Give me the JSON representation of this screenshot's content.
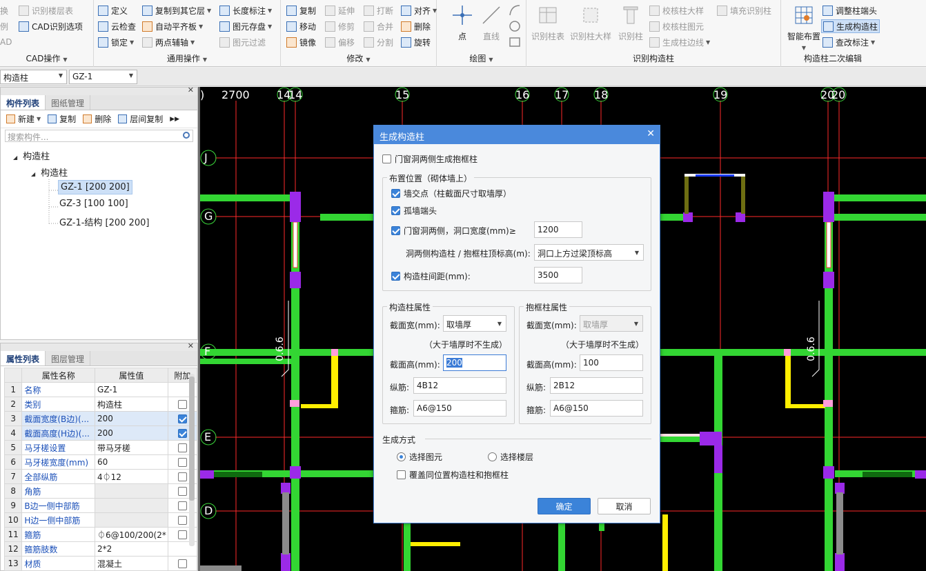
{
  "ribbon": {
    "cad_group": {
      "label": "CAD操作",
      "items": [
        "识别楼层表",
        "CAD识别选项"
      ],
      "partial_items": [
        "换",
        "例",
        "AD"
      ]
    },
    "general_group": {
      "label": "通用操作",
      "items": [
        "定义",
        "复制到其它层",
        "长度标注",
        "云检查",
        "自动平齐板",
        "图元存盘",
        "锁定",
        "两点辅轴",
        "图元过滤"
      ]
    },
    "modify_group": {
      "label": "修改",
      "items": [
        "复制",
        "延伸",
        "打断",
        "对齐",
        "移动",
        "修剪",
        "合并",
        "删除",
        "镜像",
        "偏移",
        "分割",
        "旋转"
      ]
    },
    "draw_group": {
      "label": "绘图",
      "items": [
        "点",
        "直线"
      ]
    },
    "identify_group": {
      "label": "识别构造柱",
      "items": [
        "识别柱表",
        "识别柱大样",
        "识别柱",
        "校核柱大样",
        "填充识别柱",
        "校核柱图元",
        "生成柱边线"
      ]
    },
    "edit_group": {
      "label": "构造柱二次编辑",
      "items": [
        "智能布置",
        "调整柱端头",
        "生成构造柱",
        "查改标注"
      ]
    }
  },
  "selectors": {
    "type": "构造柱",
    "name": "GZ-1"
  },
  "component_panel": {
    "tabs": [
      "构件列表",
      "图纸管理"
    ],
    "tools": [
      "新建",
      "复制",
      "删除",
      "层间复制"
    ],
    "search_placeholder": "搜索构件...",
    "tree": {
      "root": "构造柱",
      "child": "构造柱",
      "items": [
        "GZ-1 [200 200]",
        "GZ-3 [100 100]",
        "GZ-1-结构 [200 200]"
      ]
    }
  },
  "property_panel": {
    "tabs": [
      "属性列表",
      "图层管理"
    ],
    "headers": [
      "属性名称",
      "属性值",
      "附加"
    ],
    "rows": [
      {
        "no": "1",
        "name": "名称",
        "value": "GZ-1",
        "check": null
      },
      {
        "no": "2",
        "name": "类别",
        "value": "构造柱",
        "check": false
      },
      {
        "no": "3",
        "name": "截面宽度(B边)(...",
        "value": "200",
        "check": true
      },
      {
        "no": "4",
        "name": "截面高度(H边)(...",
        "value": "200",
        "check": true
      },
      {
        "no": "5",
        "name": "马牙槎设置",
        "value": "带马牙槎",
        "check": false
      },
      {
        "no": "6",
        "name": "马牙槎宽度(mm)",
        "value": "60",
        "check": false
      },
      {
        "no": "7",
        "name": "全部纵筋",
        "value": "4⏀12",
        "check": false
      },
      {
        "no": "8",
        "name": "角筋",
        "value": "",
        "check": false
      },
      {
        "no": "9",
        "name": "B边一侧中部筋",
        "value": "",
        "check": false
      },
      {
        "no": "10",
        "name": "H边一侧中部筋",
        "value": "",
        "check": false
      },
      {
        "no": "11",
        "name": "箍筋",
        "value": "⏀6@100/200(2*",
        "check": false
      },
      {
        "no": "12",
        "name": "箍筋肢数",
        "value": "2*2",
        "check": null
      },
      {
        "no": "13",
        "name": "材质",
        "value": "混凝土",
        "check": false
      }
    ]
  },
  "canvas": {
    "axis_top": [
      "2700",
      "14",
      "14",
      "15",
      "16",
      "17",
      "18",
      "19",
      "20",
      "20"
    ],
    "axis_left": [
      "J",
      "G",
      "F",
      "E",
      "D"
    ],
    "dims": [
      "0.6.6",
      "0.6.6"
    ]
  },
  "dialog": {
    "title": "生成构造柱",
    "door_window_frame": "门窗洞两侧生成抱框柱",
    "placement": {
      "title": "布置位置（砌体墙上）",
      "wall_intersection": "墙交点（柱截面尺寸取墙厚）",
      "isolated_wall_end": "孤墙端头",
      "opening_sides": "门窗洞两侧，洞口宽度(mm)≥",
      "opening_width": "1200",
      "top_elev_label": "洞两侧构造柱 / 抱框柱顶标高(m):",
      "top_elev_value": "洞口上方过梁顶标高",
      "spacing_label": "构造柱间距(mm):",
      "spacing_value": "3500"
    },
    "gz_props": {
      "title": "构造柱属性",
      "width_label": "截面宽(mm):",
      "width_value": "取墙厚",
      "note": "（大于墙厚时不生成）",
      "height_label": "截面高(mm):",
      "height_value": "200",
      "long_label": "纵筋:",
      "long_value": "4B12",
      "stirrup_label": "箍筋:",
      "stirrup_value": "A6@150"
    },
    "bkz_props": {
      "title": "抱框柱属性",
      "width_label": "截面宽(mm):",
      "width_value": "取墙厚",
      "note": "（大于墙厚时不生成）",
      "height_label": "截面高(mm):",
      "height_value": "100",
      "long_label": "纵筋:",
      "long_value": "2B12",
      "stirrup_label": "箍筋:",
      "stirrup_value": "A6@150"
    },
    "mode": {
      "title": "生成方式",
      "opt1": "选择图元",
      "opt2": "选择楼层",
      "overwrite": "覆盖同位置构造柱和抱框柱"
    },
    "ok": "确定",
    "cancel": "取消"
  }
}
